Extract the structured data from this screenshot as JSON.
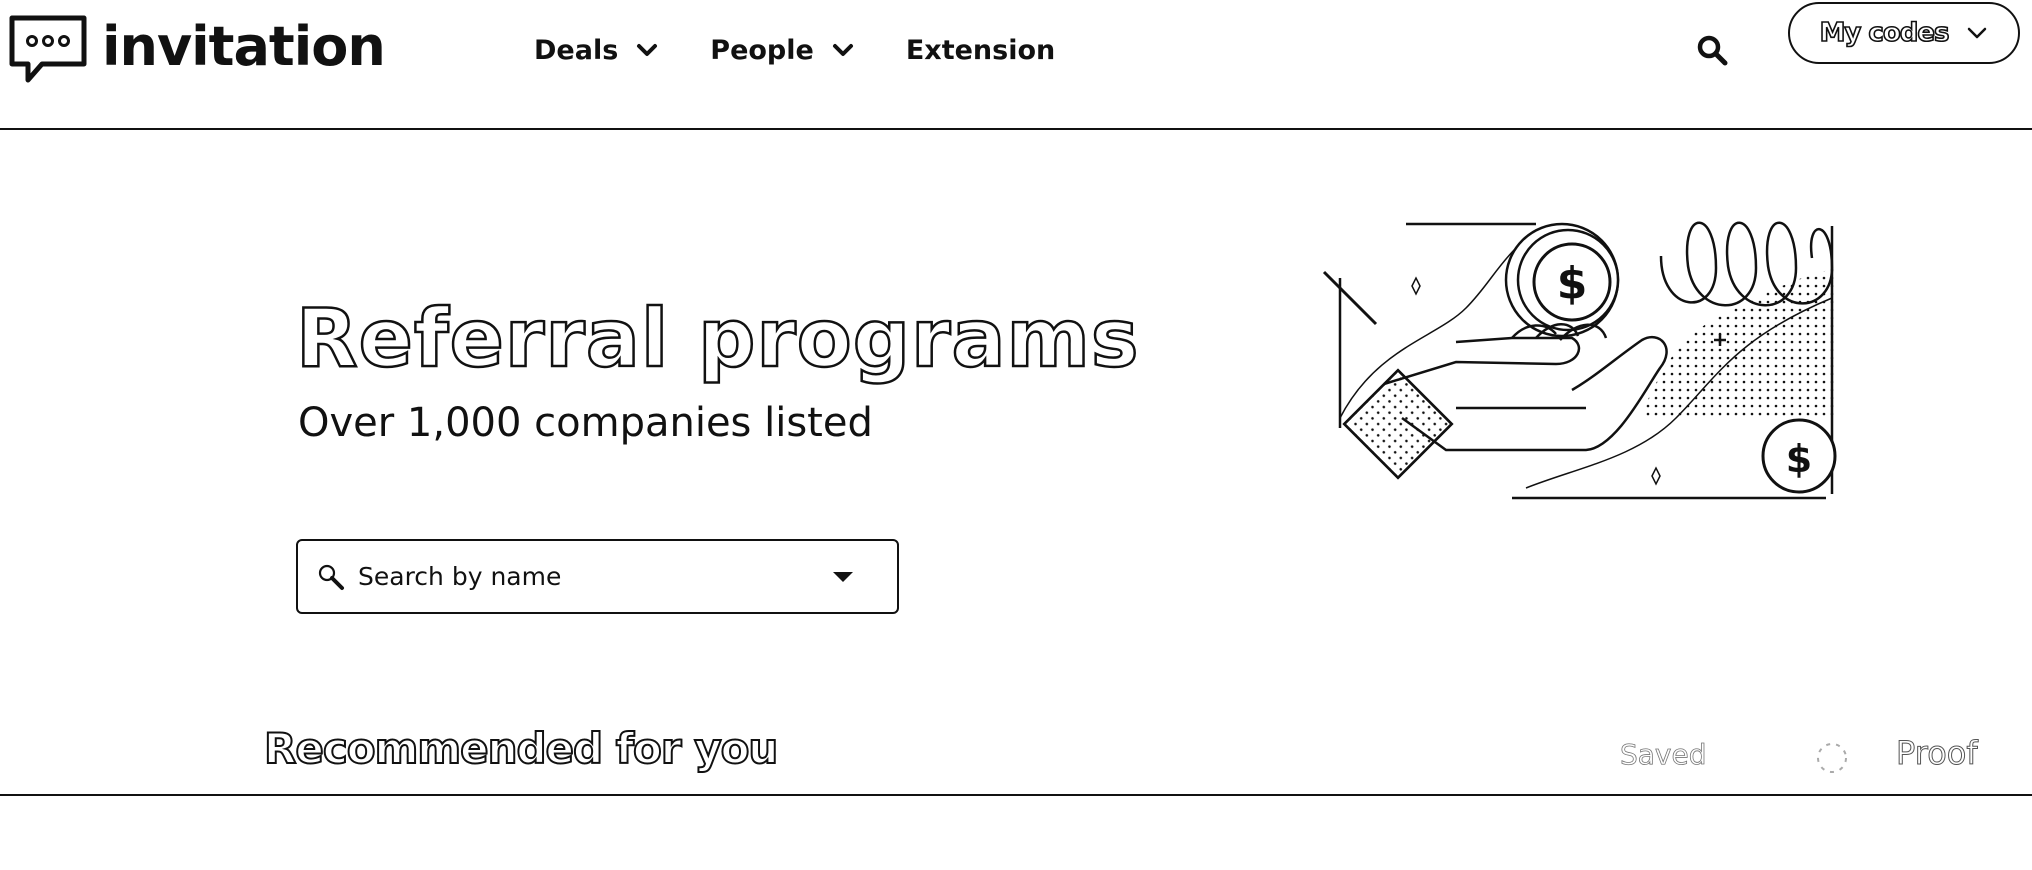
{
  "header": {
    "logo_text": "invitation",
    "nav": [
      {
        "label": "Deals",
        "icon": "chevron-down-icon"
      },
      {
        "label": "People",
        "icon": "chevron-down-icon"
      },
      {
        "label": "Extension"
      }
    ],
    "search_icon": "search-icon",
    "my_codes_label": "My codes"
  },
  "hero": {
    "title": "Referral programs",
    "subtitle": "Over 1,000 companies listed",
    "search": {
      "placeholder": "Search by name",
      "value": ""
    },
    "illustration": "hand-holding-coins-illustration"
  },
  "recommended": {
    "title": "Recommended for you",
    "saved_label": "Saved",
    "proof_label": "Proof"
  },
  "colors": {
    "text": "#111111",
    "background": "#ffffff",
    "faint": "#c8c8c8"
  }
}
